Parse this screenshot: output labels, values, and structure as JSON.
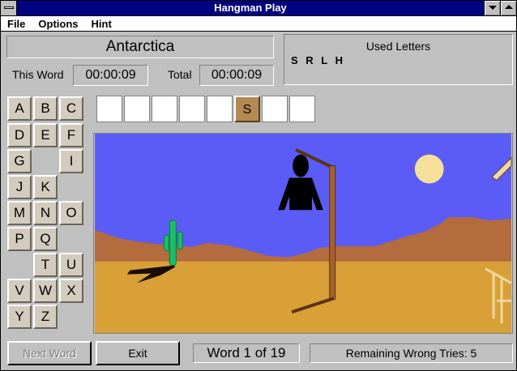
{
  "window": {
    "title": "Hangman Play"
  },
  "menu": [
    "File",
    "Options",
    "Hint"
  ],
  "word": "Antarctica",
  "timers": {
    "this_word_label": "This Word",
    "this_word": "00:00:09",
    "total_label": "Total",
    "total": "00:00:09"
  },
  "used": {
    "title": "Used Letters",
    "letters": "S R L H"
  },
  "keyboard": {
    "keys": [
      "A",
      "B",
      "C",
      "D",
      "E",
      "F",
      "G",
      "I",
      "J",
      "K",
      "M",
      "N",
      "O",
      "P",
      "Q",
      "T",
      "U",
      "V",
      "W",
      "X",
      "Y",
      "Z"
    ],
    "missing_used": [
      "H",
      "L",
      "R",
      "S"
    ]
  },
  "slots": [
    "",
    "",
    "",
    "",
    "",
    "S",
    "",
    ""
  ],
  "buttons": {
    "next": "Next Word",
    "exit": "Exit"
  },
  "status": {
    "word_count": "Word 1 of 19",
    "remaining": "Remaining Wrong Tries: 5"
  },
  "colors": {
    "sky": "#5b5cf5",
    "sand": "#d9a037",
    "mountain": "#b46c3e",
    "sun": "#f5e09a",
    "cactus": "#1cbd6a",
    "gallows": "#a5602d",
    "title_bar": "#000080"
  }
}
